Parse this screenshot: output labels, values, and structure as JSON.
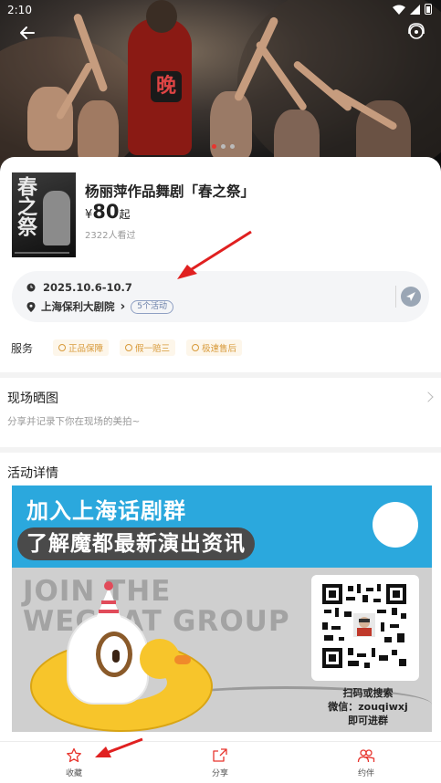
{
  "status_bar": {
    "time": "2:10"
  },
  "event": {
    "title": "杨丽萍作品舞剧「春之祭」",
    "price_currency": "¥",
    "price_value": "80",
    "price_suffix": "起",
    "viewers": "2322人看过",
    "poster_text": "春之祭",
    "hero_mark": "晚"
  },
  "info": {
    "date": "2025.10.6-10.7",
    "venue": "上海保利大剧院",
    "venue_chevron": "›",
    "activity_count": "5个活动"
  },
  "services": {
    "label": "服务",
    "items": [
      "正品保障",
      "假一赔三",
      "极速售后"
    ]
  },
  "live_photos": {
    "title": "现场晒图",
    "subtitle": "分享并记录下你在现场的美拍~"
  },
  "details": {
    "title": "活动详情",
    "banner": {
      "headline": "加入上海话剧群",
      "subheadline": "了解魔都最新演出资讯",
      "join_line1": "JOIN THE",
      "join_line2": "WECHAT",
      "join_line3": "GROUP",
      "qr_caption_1": "扫码或搜索",
      "qr_caption_2": "微信：zouqiwxj",
      "qr_caption_3": "即可进群"
    }
  },
  "bottom_bar": {
    "favorite": "收藏",
    "share": "分享",
    "companion": "约伴"
  },
  "colors": {
    "accent": "#e8352e",
    "service_chip_text": "#d89a3a",
    "banner_blue": "#2ba8dd"
  },
  "icons": [
    "back-arrow-icon",
    "customer-service-icon",
    "clock-icon",
    "location-pin-icon",
    "navigate-icon",
    "star-icon",
    "share-icon",
    "people-icon"
  ]
}
